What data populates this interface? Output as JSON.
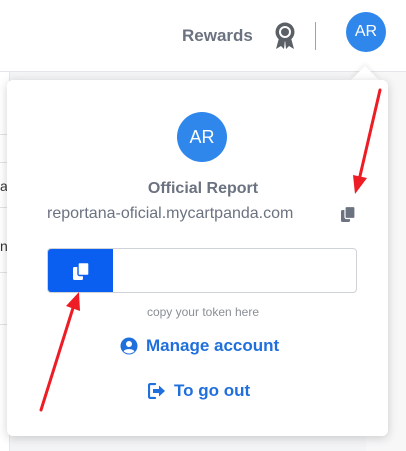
{
  "header": {
    "rewards_label": "Rewards",
    "avatar_initials": "AR"
  },
  "background": {
    "row_glyph_1": "a",
    "row_glyph_2": "n"
  },
  "popup": {
    "avatar_initials": "AR",
    "store_name": "Official Report",
    "store_domain": "reportana-oficial.mycartpanda.com",
    "token_value": "",
    "token_hint": "copy your token here",
    "manage_account_label": "Manage account",
    "logout_label": "To go out"
  },
  "colors": {
    "brand_blue": "#2f86eb",
    "button_blue": "#0a5ef0",
    "link_blue": "#1f6fdc",
    "annotation_red": "#ee1c24"
  },
  "icons": {
    "rewards": "award-ribbon-icon",
    "copy": "copy-icon",
    "account": "user-circle-icon",
    "logout": "sign-out-icon"
  }
}
